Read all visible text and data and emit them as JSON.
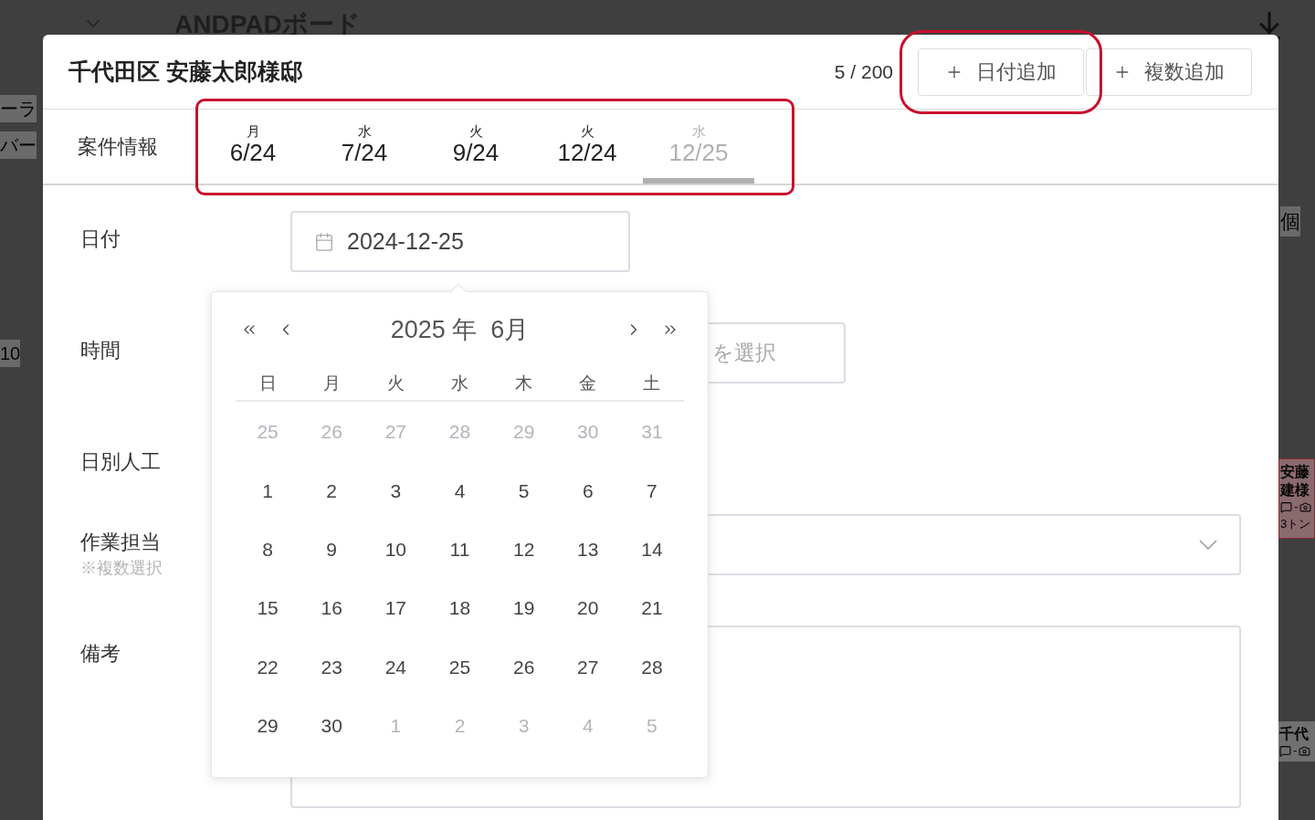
{
  "background": {
    "board_title": "ANDPADボード",
    "left_fragments": [
      "ーラ",
      "バー",
      "10"
    ],
    "right_fragments": [
      "個"
    ],
    "cards": [
      {
        "lines": [
          "安藤",
          "建様"
        ],
        "meta": "-",
        "note": "3トン",
        "tinted": true
      },
      {
        "lines": [
          "千代"
        ],
        "meta": "-",
        "tinted": false
      }
    ]
  },
  "dialog": {
    "title": "千代田区 安藤太郎様邸",
    "counter": "5 / 200",
    "buttons": [
      {
        "label": "日付追加",
        "highlighted": true
      },
      {
        "label": "複数追加",
        "highlighted": false
      }
    ],
    "section_label": "案件情報",
    "tabs_highlighted": true,
    "date_tabs": [
      {
        "weekday": "月",
        "date": "6/24",
        "selected": false
      },
      {
        "weekday": "水",
        "date": "7/24",
        "selected": false
      },
      {
        "weekday": "火",
        "date": "9/24",
        "selected": false
      },
      {
        "weekday": "火",
        "date": "12/24",
        "selected": false
      },
      {
        "weekday": "水",
        "date": "12/25",
        "selected": true
      }
    ],
    "fields": [
      {
        "label": "日付",
        "kind": "date",
        "value": "2024-12-25"
      },
      {
        "label": "時間",
        "kind": "select",
        "placeholder": "を選択"
      },
      {
        "label": "日別人工",
        "kind": "none"
      },
      {
        "label": "作業担当",
        "note": "※複数選択",
        "kind": "dropdown"
      },
      {
        "label": "備考",
        "kind": "textarea"
      }
    ]
  },
  "date_picker": {
    "title": "2025 年  6月",
    "weekdays": [
      "日",
      "月",
      "火",
      "水",
      "木",
      "金",
      "土"
    ],
    "weeks": [
      [
        {
          "day": "25",
          "outside": true
        },
        {
          "day": "26",
          "outside": true
        },
        {
          "day": "27",
          "outside": true
        },
        {
          "day": "28",
          "outside": true
        },
        {
          "day": "29",
          "outside": true
        },
        {
          "day": "30",
          "outside": true
        },
        {
          "day": "31",
          "outside": true
        }
      ],
      [
        {
          "day": "1",
          "outside": false
        },
        {
          "day": "2",
          "outside": false
        },
        {
          "day": "3",
          "outside": false
        },
        {
          "day": "4",
          "outside": false
        },
        {
          "day": "5",
          "outside": false
        },
        {
          "day": "6",
          "outside": false
        },
        {
          "day": "7",
          "outside": false
        }
      ],
      [
        {
          "day": "8",
          "outside": false
        },
        {
          "day": "9",
          "outside": false
        },
        {
          "day": "10",
          "outside": false
        },
        {
          "day": "11",
          "outside": false
        },
        {
          "day": "12",
          "outside": false
        },
        {
          "day": "13",
          "outside": false
        },
        {
          "day": "14",
          "outside": false
        }
      ],
      [
        {
          "day": "15",
          "outside": false
        },
        {
          "day": "16",
          "outside": false
        },
        {
          "day": "17",
          "outside": false
        },
        {
          "day": "18",
          "outside": false
        },
        {
          "day": "19",
          "outside": false
        },
        {
          "day": "20",
          "outside": false
        },
        {
          "day": "21",
          "outside": false
        }
      ],
      [
        {
          "day": "22",
          "outside": false
        },
        {
          "day": "23",
          "outside": false
        },
        {
          "day": "24",
          "outside": false
        },
        {
          "day": "25",
          "outside": false
        },
        {
          "day": "26",
          "outside": false
        },
        {
          "day": "27",
          "outside": false
        },
        {
          "day": "28",
          "outside": false
        }
      ],
      [
        {
          "day": "29",
          "outside": false
        },
        {
          "day": "30",
          "outside": false
        },
        {
          "day": "1",
          "outside": true
        },
        {
          "day": "2",
          "outside": true
        },
        {
          "day": "3",
          "outside": true
        },
        {
          "day": "4",
          "outside": true
        },
        {
          "day": "5",
          "outside": true
        }
      ]
    ]
  }
}
